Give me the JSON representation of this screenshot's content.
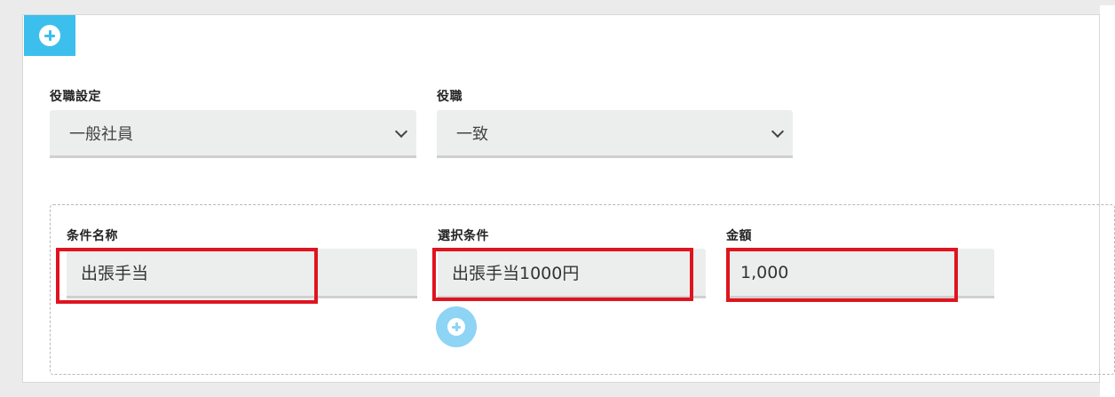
{
  "fields": {
    "position_setting": {
      "label": "役職設定",
      "value": "一般社員"
    },
    "position": {
      "label": "役職",
      "value": "一致"
    }
  },
  "condition": {
    "name": {
      "label": "条件名称",
      "value": "出張手当"
    },
    "selection": {
      "label": "選択条件",
      "value": "出張手当1000円"
    },
    "amount": {
      "label": "金額",
      "value": "1,000"
    }
  },
  "colors": {
    "accent": "#3cbfed",
    "highlight": "#e0141e",
    "field_bg": "#eceeee"
  },
  "icons": {
    "add_section": "plus-circle-icon",
    "add_condition": "plus-circle-icon",
    "dropdown": "chevron-down-icon"
  }
}
